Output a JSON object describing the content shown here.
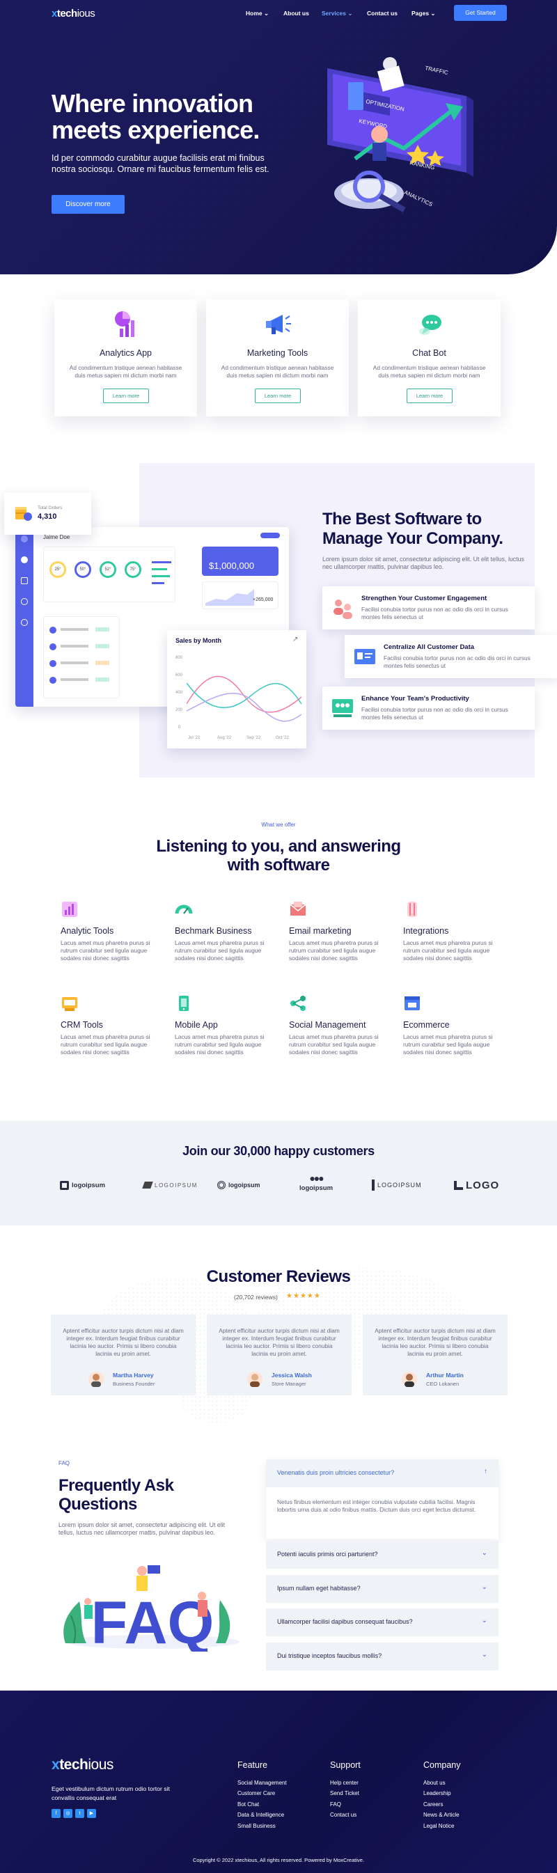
{
  "nav": {
    "brand_x": "x",
    "brand_main": "tech",
    "brand_end": "ious",
    "items": [
      "Home",
      "About us",
      "Services",
      "Contact us",
      "Pages"
    ],
    "cta": "Get Started"
  },
  "hero": {
    "title": "Where innovation meets experience.",
    "subtitle": "Id per commodo curabitur augue facilisis erat mi finibus nostra sociosqu. Ornare mi faucibus fermentum felis est.",
    "button": "Discover more",
    "illustration_labels": [
      "OPTIMIZATION",
      "TRAFFIC",
      "KEYWORD",
      "RANKING",
      "ANALYTICS"
    ]
  },
  "features": [
    {
      "title": "Analytics App",
      "desc": "Ad condimentum tristique aenean habitasse duis metus sapien mi dictum morbi nam",
      "button": "Learn more"
    },
    {
      "title": "Marketing Tools",
      "desc": "Ad condimentum tristique aenean habitasse duis metus sapien mi dictum morbi nam",
      "button": "Learn more"
    },
    {
      "title": "Chat Bot",
      "desc": "Ad condimentum tristique aenean habitasse duis metus sapien mi dictum morbi nam",
      "button": "Learn more"
    }
  ],
  "software": {
    "title": "The Best Software to Manage Your Company.",
    "desc": "Lorem ipsum dolor sit amet, consectetur adipiscing elit. Ut elit tellus, luctus nec ullamcorper mattis, pulvinar dapibus leo.",
    "cards": [
      {
        "title": "Strengthen Your Customer Engagement",
        "desc": "Facilisi conubia tortor purus non ac odio dis orci in cursus montes felis senectus ut"
      },
      {
        "title": "Centralize All Customer Data",
        "desc": "Facilisi conubia tortor purus non ac odio dis orci in cursus montes felis senectus ut"
      },
      {
        "title": "Enhance Your Team's Productivity",
        "desc": "Facilisi conubia tortor purus non ac odio dis orci in cursus montes felis senectus ut"
      }
    ],
    "dashboard": {
      "total_orders_label": "Total Orders",
      "total_orders_value": "4,310",
      "user": "Jaime Doe",
      "big_value": "1,000,000",
      "small_value": "265,000",
      "gauges": [
        "25°",
        "50°",
        "52°",
        "75°"
      ],
      "sales_title": "Sales by Month",
      "sales_y_ticks": [
        "800",
        "600",
        "400",
        "200",
        "0"
      ],
      "sales_x_ticks": [
        "Jul '22",
        "Aug '22",
        "Sep '22",
        "Oct '22"
      ]
    }
  },
  "services": {
    "kicker": "What we offer",
    "title": "Listening to you, and answering with software",
    "items": [
      {
        "title": "Analytic Tools",
        "desc": "Lacus amet mus pharetra purus si rutrum curabitur sed ligula augue sodales nisi donec sagittis"
      },
      {
        "title": "Bechmark Business",
        "desc": "Lacus amet mus pharetra purus si rutrum curabitur sed ligula augue sodales nisi donec sagittis"
      },
      {
        "title": "Email marketing",
        "desc": "Lacus amet mus pharetra purus si rutrum curabitur sed ligula augue sodales nisi donec sagittis"
      },
      {
        "title": "Integrations",
        "desc": "Lacus amet mus pharetra purus si rutrum curabitur sed ligula augue sodales nisi donec sagittis"
      },
      {
        "title": "CRM Tools",
        "desc": "Lacus amet mus pharetra purus si rutrum curabitur sed ligula augue sodales nisi donec sagittis"
      },
      {
        "title": "Mobile App",
        "desc": "Lacus amet mus pharetra purus si rutrum curabitur sed ligula augue sodales nisi donec sagittis"
      },
      {
        "title": "Social Management",
        "desc": "Lacus amet mus pharetra purus si rutrum curabitur sed ligula augue sodales nisi donec sagittis"
      },
      {
        "title": "Ecommerce",
        "desc": "Lacus amet mus pharetra purus si rutrum curabitur sed ligula augue sodales nisi donec sagittis"
      }
    ]
  },
  "customers": {
    "title": "Join our 30,000 happy customers",
    "logos": [
      "logoipsum",
      "LOGOIPSUM",
      "logoipsum",
      "logoipsum",
      "LOGOIPSUM",
      "LOGO"
    ]
  },
  "reviews": {
    "title": "Customer Reviews",
    "count": "(20,702 reviews)",
    "stars": "★★★★★",
    "items": [
      {
        "quote": "Aptent efficitur auctor turpis dictum nisi at diam integer ex. Interdum feugiat finibus curabitur lacinia leo auctor. Primis si libero conubia lacinia eu proin amet.",
        "name": "Martha Harvey",
        "role": "Business Founder"
      },
      {
        "quote": "Aptent efficitur auctor turpis dictum nisi at diam integer ex. Interdum feugiat finibus curabitur lacinia leo auctor. Primis si libero conubia lacinia eu proin amet.",
        "name": "Jessica Walsh",
        "role": "Store Manager"
      },
      {
        "quote": "Aptent efficitur auctor turpis dictum nisi at diam integer ex. Interdum feugiat finibus curabitur lacinia leo auctor. Primis si libero conubia lacinia eu proin amet.",
        "name": "Arthur Martin",
        "role": "CEO Lokanen"
      }
    ]
  },
  "faq": {
    "kicker": "FAQ",
    "title": "Frequently Ask Questions",
    "desc": "Lorem ipsum dolor sit amet, consectetur adipiscing elit. Ut elit tellus, luctus nec ullamcorper mattis, pulvinar dapibus leo.",
    "art_text": "FAQ",
    "open": {
      "question": "Venenatis duis proin ultricies consectetur?",
      "answer": "Netus finibus elementum est integer conubia vulputate cubilia facilisi. Magnis lobortis urna duis at odio finibus mattis. Dictum duis orci eget lectus dictumst."
    },
    "items": [
      "Potenti iaculis primis orci parturient?",
      "Ipsum nullam eget habitasse?",
      "Ullamcorper facilisi dapibus consequat faucibus?",
      "Dui tristique inceptos faucibus mollis?"
    ]
  },
  "footer": {
    "brand_x": "x",
    "brand_main": "tech",
    "brand_end": "ious",
    "desc": "Eget vestibulum dictum rutrum odio tortor sit convallis consequat erat",
    "social": [
      "f",
      "◎",
      "t",
      "▶"
    ],
    "columns": [
      {
        "title": "Feature",
        "links": [
          "Social Management",
          "Customer Care",
          "Bot Chat",
          "Data & Intelligence",
          "Small Business"
        ]
      },
      {
        "title": "Support",
        "links": [
          "Help center",
          "Send Ticket",
          "FAQ",
          "Contact us"
        ]
      },
      {
        "title": "Company",
        "links": [
          "About us",
          "Leadership",
          "Careers",
          "News & Article",
          "Legal Notice"
        ]
      }
    ],
    "copyright": "Copyright © 2022 xtechious, All rights reserved. Powered by MoxCreative."
  },
  "colors": {
    "hero_bg": "#1b1a5e",
    "accent": "#3d7bff",
    "heading": "#12124a",
    "teal": "#38b3a3",
    "star": "#f5a623"
  }
}
